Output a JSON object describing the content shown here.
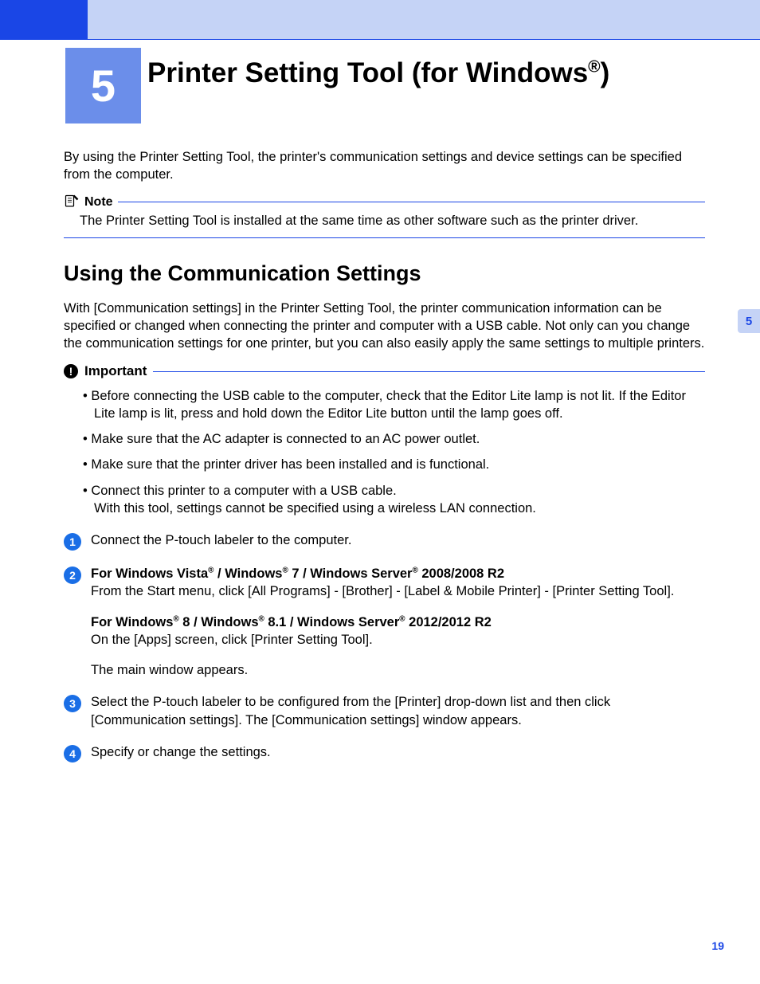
{
  "header": {
    "chapter_number": "5",
    "title_pre": "Printer Setting Tool (for Windows",
    "title_reg": "®",
    "title_post": ")"
  },
  "intro": "By using the Printer Setting Tool, the printer's communication settings and device settings can be specified from the computer.",
  "note": {
    "label": "Note",
    "body": "The Printer Setting Tool is installed at the same time as other software such as the printer driver."
  },
  "section": {
    "title": "Using the Communication Settings",
    "intro": "With [Communication settings] in the Printer Setting Tool, the printer communication information can be specified or changed when connecting the printer and computer with a USB cable. Not only can you change the communication settings for one printer, but you can also easily apply the same settings to multiple printers."
  },
  "important": {
    "label": "Important",
    "items": [
      "Before connecting the USB cable to the computer, check that the Editor Lite lamp is not lit. If the Editor Lite lamp is lit, press and hold down the Editor Lite button until the lamp goes off.",
      "Make sure that the AC adapter is connected to an AC power outlet.",
      "Make sure that the printer driver has been installed and is functional.",
      "Connect this printer to a computer with a USB cable.\nWith this tool, settings cannot be specified using a wireless LAN connection."
    ]
  },
  "steps": [
    {
      "n": "1",
      "plain": "Connect the P-touch labeler to the computer."
    },
    {
      "n": "2",
      "line1_bold_parts": [
        "For Windows Vista",
        "®",
        " / Windows",
        "®",
        " 7 / Windows Server",
        "®",
        " 2008/2008 R2"
      ],
      "line1_body": "From the Start menu, click [All Programs] - [Brother] - [Label & Mobile Printer] - [Printer Setting Tool].",
      "line2_bold_parts": [
        "For Windows",
        "®",
        " 8 / Windows",
        "®",
        " 8.1 / Windows Server",
        "®",
        " 2012/2012 R2"
      ],
      "line2_body": "On the [Apps] screen, click [Printer Setting Tool].",
      "line3": "The main window appears."
    },
    {
      "n": "3",
      "plain": "Select the P-touch labeler to be configured from the [Printer] drop-down list and then click [Communication settings]. The [Communication settings] window appears."
    },
    {
      "n": "4",
      "plain": "Specify or change the settings."
    }
  ],
  "side_tab": "5",
  "page_number": "19"
}
